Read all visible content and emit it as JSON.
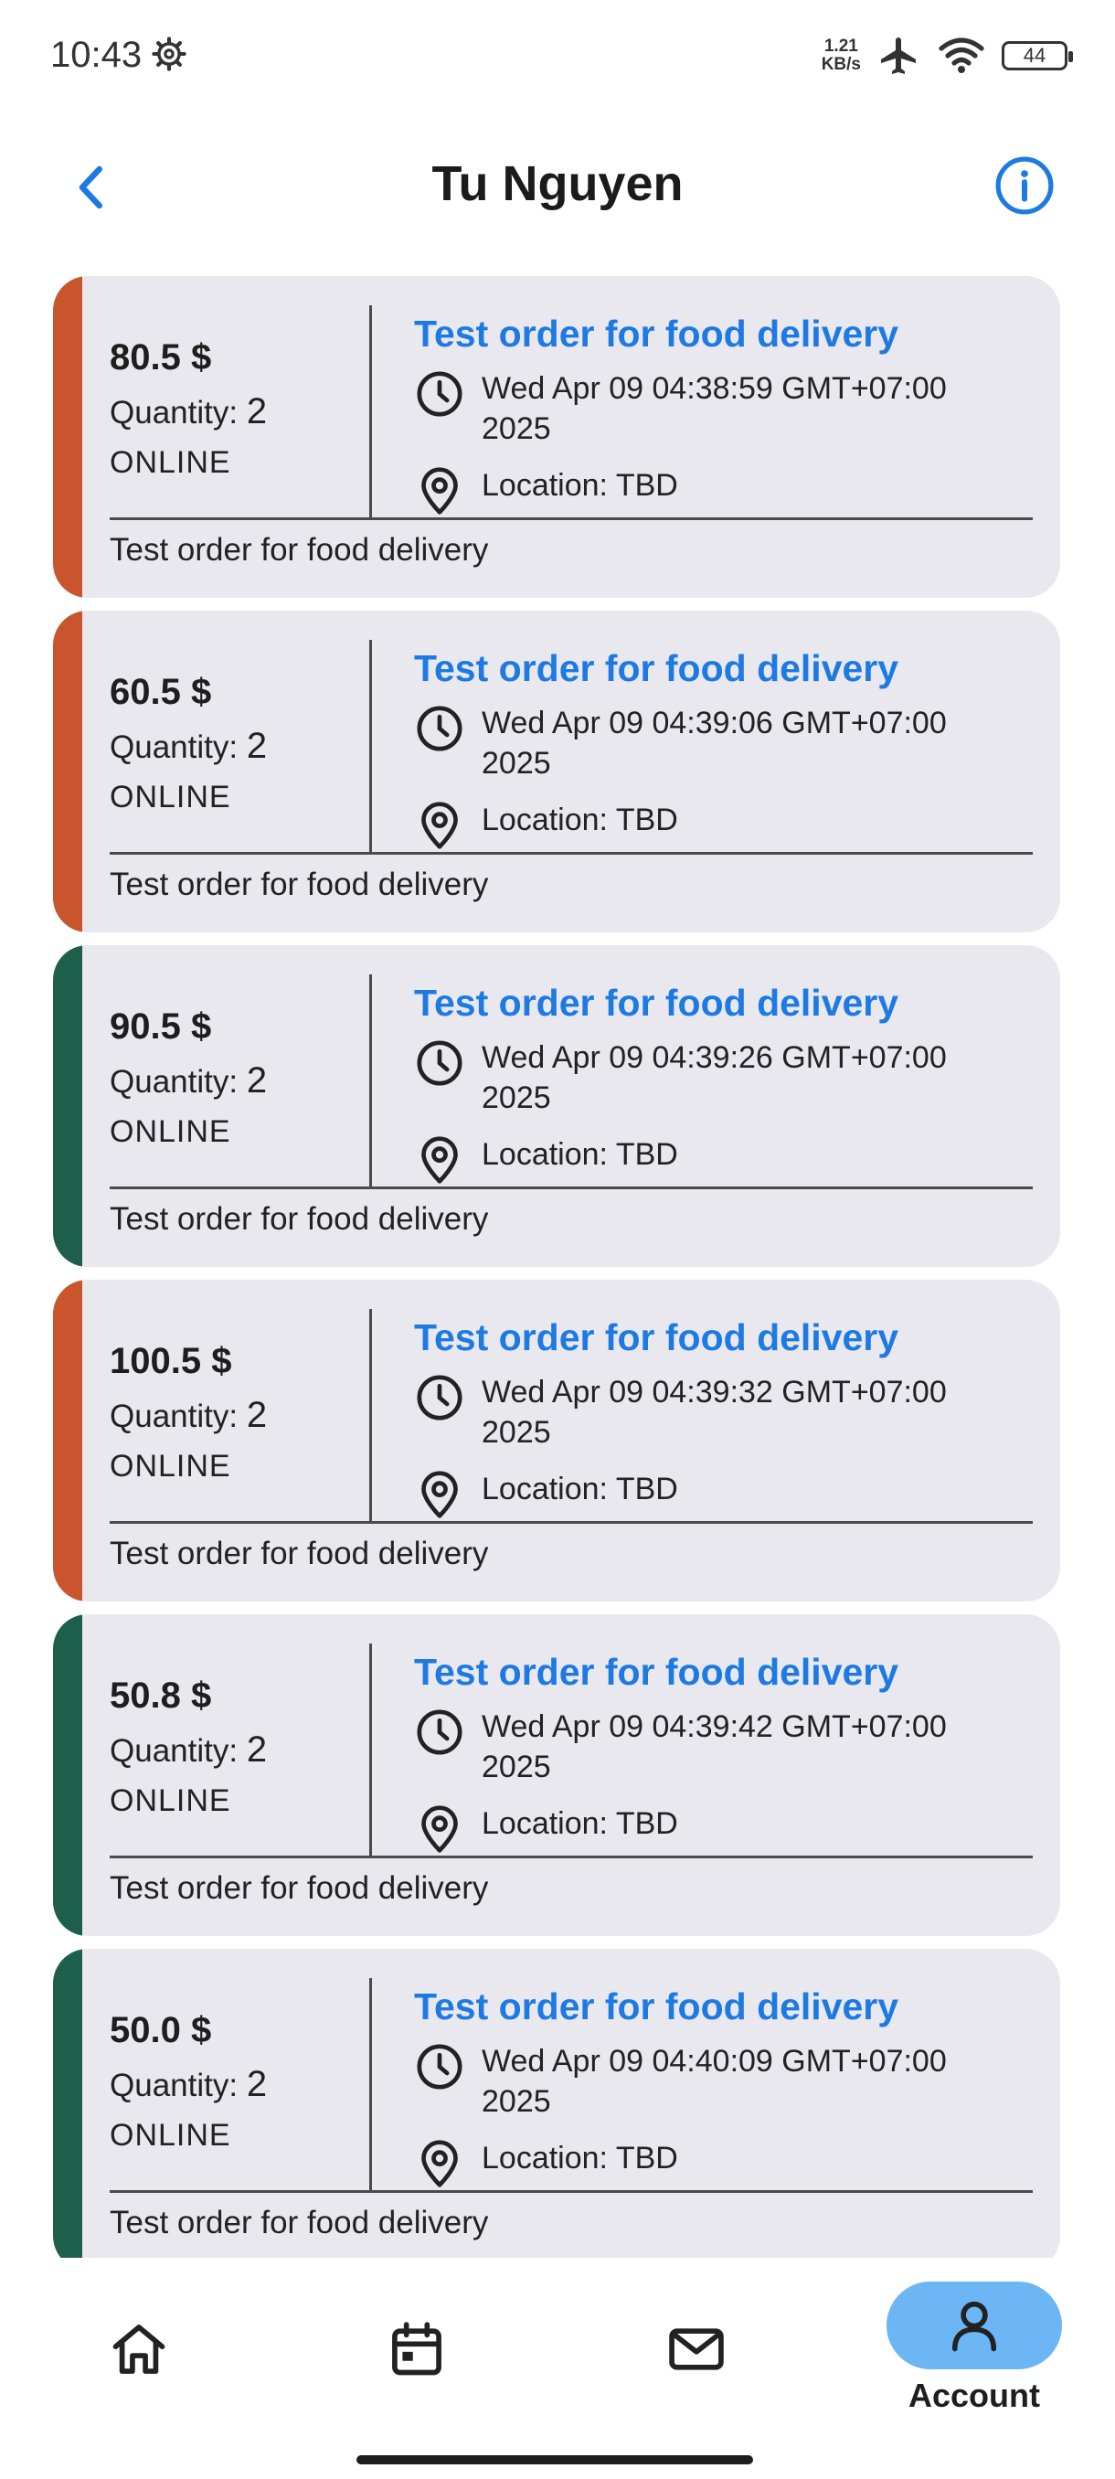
{
  "status_bar": {
    "time": "10:43",
    "net_speed_value": "1.21",
    "net_speed_unit": "KB/s",
    "battery": "44"
  },
  "header": {
    "title": "Tu Nguyen"
  },
  "colors": {
    "accent": "#1e7ae3",
    "stripe_orange": "#c9552c",
    "stripe_green": "#1e5f4b",
    "card_bg": "#e9e8ee",
    "nav_active": "#6db6f6"
  },
  "orders": [
    {
      "price": "80.5 $",
      "quantity_label": "Quantity:",
      "quantity": "2",
      "channel": "ONLINE",
      "title": "Test order for food delivery",
      "datetime_line1": "Wed Apr 09 04:38:59 GMT+07:00",
      "datetime_line2": "2025",
      "location": "Location: TBD",
      "description": "Test order for food delivery",
      "stripe": "orange"
    },
    {
      "price": "60.5 $",
      "quantity_label": "Quantity:",
      "quantity": "2",
      "channel": "ONLINE",
      "title": "Test order for food delivery",
      "datetime_line1": "Wed Apr 09 04:39:06 GMT+07:00",
      "datetime_line2": "2025",
      "location": "Location: TBD",
      "description": "Test order for food delivery",
      "stripe": "orange"
    },
    {
      "price": "90.5 $",
      "quantity_label": "Quantity:",
      "quantity": "2",
      "channel": "ONLINE",
      "title": "Test order for food delivery",
      "datetime_line1": "Wed Apr 09 04:39:26 GMT+07:00",
      "datetime_line2": "2025",
      "location": "Location: TBD",
      "description": "Test order for food delivery",
      "stripe": "green"
    },
    {
      "price": "100.5 $",
      "quantity_label": "Quantity:",
      "quantity": "2",
      "channel": "ONLINE",
      "title": "Test order for food delivery",
      "datetime_line1": "Wed Apr 09 04:39:32 GMT+07:00",
      "datetime_line2": "2025",
      "location": "Location: TBD",
      "description": "Test order for food delivery",
      "stripe": "orange"
    },
    {
      "price": "50.8 $",
      "quantity_label": "Quantity:",
      "quantity": "2",
      "channel": "ONLINE",
      "title": "Test order for food delivery",
      "datetime_line1": "Wed Apr 09 04:39:42 GMT+07:00",
      "datetime_line2": "2025",
      "location": "Location: TBD",
      "description": "Test order for food delivery",
      "stripe": "green"
    },
    {
      "price": "50.0 $",
      "quantity_label": "Quantity:",
      "quantity": "2",
      "channel": "ONLINE",
      "title": "Test order for food delivery",
      "datetime_line1": "Wed Apr 09 04:40:09 GMT+07:00",
      "datetime_line2": "2025",
      "location": "Location: TBD",
      "description": "Test order for food delivery",
      "stripe": "green"
    }
  ],
  "bottom_nav": {
    "items": [
      {
        "icon": "home-icon"
      },
      {
        "icon": "calendar-icon"
      },
      {
        "icon": "mail-icon"
      },
      {
        "icon": "account-icon",
        "label": "Account",
        "active": true
      }
    ]
  }
}
